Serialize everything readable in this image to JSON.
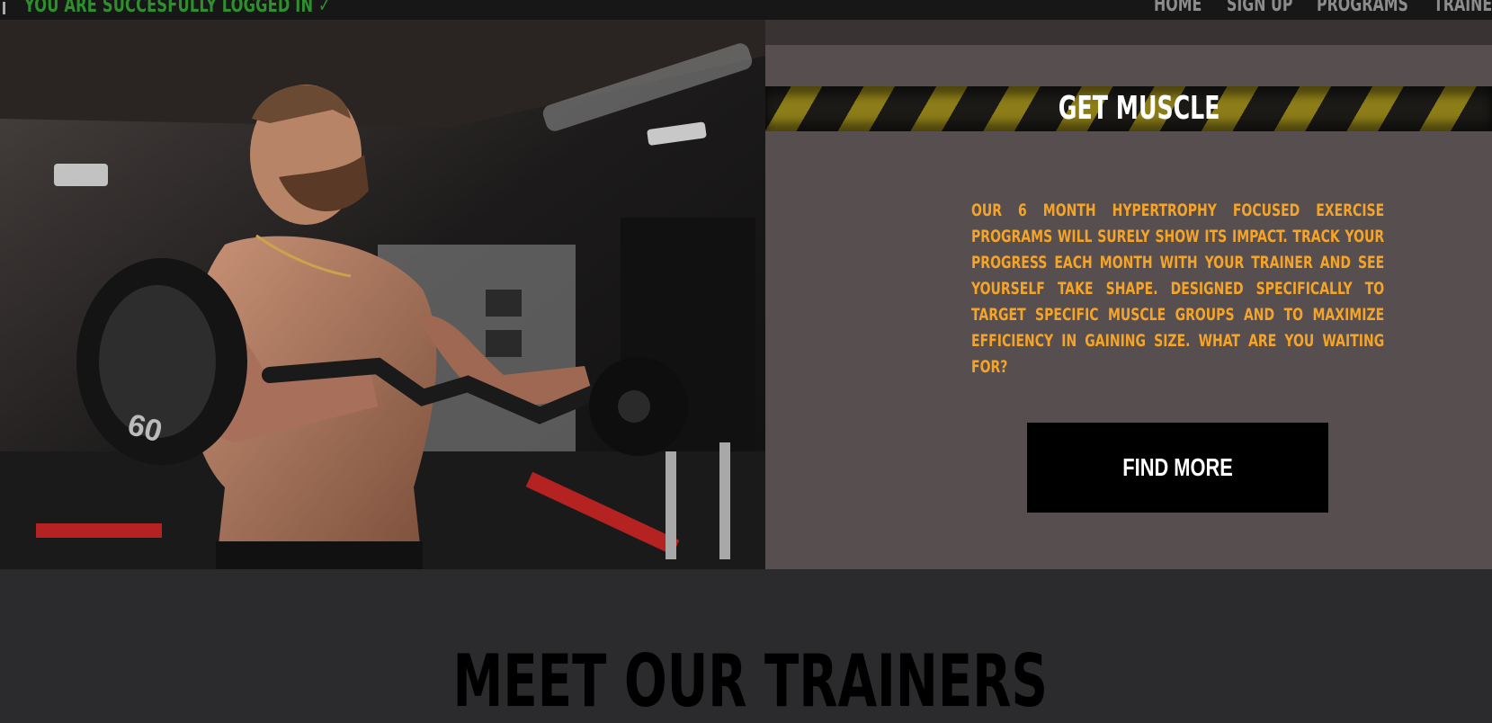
{
  "topbar": {
    "login_status": "YOU ARE SUCCESFULLY LOGGED IN ✓",
    "nav": [
      "HOME",
      "SIGN UP",
      "PROGRAMS",
      "TRAINERS"
    ]
  },
  "hero": {
    "image_description": "weightlifter-curl-photo"
  },
  "promo": {
    "title": "GET MUSCLE",
    "text": "Our 6 month hypertrophy focused exercise programs will surely show its impact. Track your progress each month with your trainer and see yourself take shape. Designed specifically to target specific muscle groups and to maximize efficiency in gaining size. What are you waiting for?",
    "button_label": "FIND MORE"
  },
  "trainers": {
    "title": "MEET OUR TRAINERS"
  },
  "colors": {
    "login_green": "#2f8f2f",
    "promo_text": "#f5a427",
    "hazard_yellow": "#8d7d18",
    "panel_bg": "#574e50"
  }
}
